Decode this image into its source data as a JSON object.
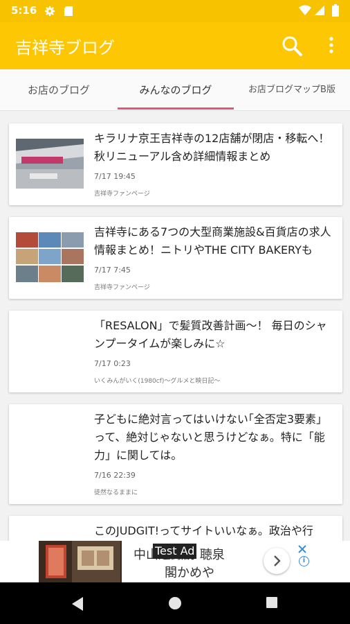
{
  "status_bar": {
    "time": "5:16"
  },
  "app_bar": {
    "title": "吉祥寺ブログ"
  },
  "tabs": [
    {
      "label": "お店のブログ"
    },
    {
      "label": "みんなのブログ"
    },
    {
      "label": "お店ブログマップB版"
    }
  ],
  "articles": [
    {
      "title": "キラリナ京王吉祥寺の12店舗が閉店・移転へ！秋リニューアル含め詳細情報まとめ",
      "date": "7/17 19:45",
      "source": "吉祥寺ファンページ"
    },
    {
      "title": "吉祥寺にある7つの大型商業施設&百貨店の求人情報まとめ！ニトリやTHE CITY BAKERYも",
      "date": "7/17 7:45",
      "source": "吉祥寺ファンページ"
    },
    {
      "title": "「RESALON」で髪質改善計画〜！ 毎日のシャンプータイムが楽しみに☆",
      "date": "7/17 0:23",
      "source": "いくみんがいく(1980cf)〜グルメと映日記〜"
    },
    {
      "title": "子どもに絶対言ってはいけない｢全否定3要素｣って、絶対じゃないと思うけどなぁ。特に「能力」に関しては。",
      "date": "7/16 22:39",
      "source": "徒然なるままに"
    },
    {
      "title": "このJUDGIT!ってサイトいいなぁ。政治や行",
      "date": "",
      "source": ""
    }
  ],
  "ad": {
    "line1": "中山道諏訪 聴泉",
    "line2": "閣かめや",
    "label": "Test Ad"
  },
  "colors": {
    "app_bar": "#fdc703",
    "tab_indicator": "#e2587a"
  }
}
